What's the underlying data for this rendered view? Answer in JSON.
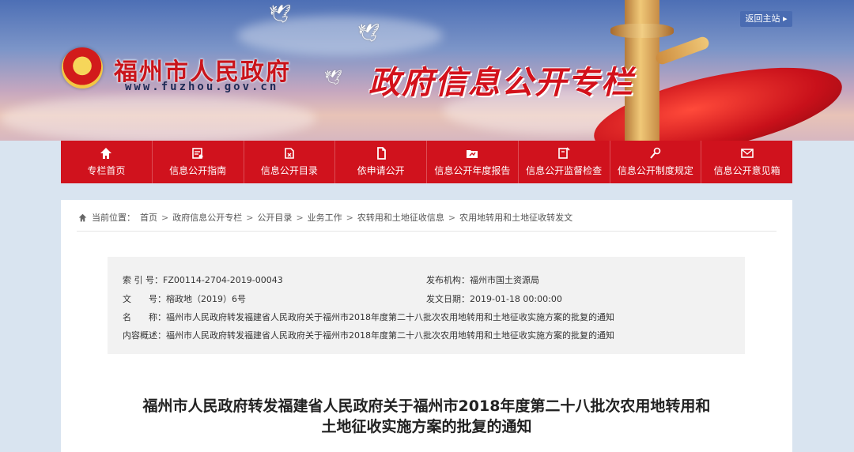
{
  "header": {
    "site_title": "福州市人民政府",
    "site_url": "www.fuzhou.gov.cn",
    "column_title": "政府信息公开专栏",
    "return_label": "返回主站"
  },
  "nav": {
    "items": [
      {
        "label": "专栏首页",
        "icon": "home-icon"
      },
      {
        "label": "信息公开指南",
        "icon": "guide-icon"
      },
      {
        "label": "信息公开目录",
        "icon": "catalog-icon"
      },
      {
        "label": "依申请公开",
        "icon": "document-icon"
      },
      {
        "label": "信息公开年度报告",
        "icon": "report-icon"
      },
      {
        "label": "信息公开监督检查",
        "icon": "inspection-icon"
      },
      {
        "label": "信息公开制度规定",
        "icon": "regulation-icon"
      },
      {
        "label": "信息公开意见箱",
        "icon": "mail-icon"
      }
    ],
    "colors": {
      "background": "#d0121d"
    }
  },
  "breadcrumb": {
    "prefix": "当前位置：",
    "items": [
      "首页",
      "政府信息公开专栏",
      "公开目录",
      "业务工作",
      "农转用和土地征收信息",
      "农用地转用和土地征收转发文"
    ],
    "separator": ">"
  },
  "meta": {
    "index_key": "索 引 号：",
    "index_value": "FZ00114-2704-2019-00043",
    "publisher_key": "发布机构：",
    "publisher_value": "福州市国土资源局",
    "docno_key": "文　　号：",
    "docno_value": "榕政地（2019）6号",
    "date_key": "发文日期：",
    "date_value": "2019-01-18 00:00:00",
    "name_key": "名　　称：",
    "name_value": "福州市人民政府转发福建省人民政府关于福州市2018年度第二十八批次农用地转用和土地征收实施方案的批复的通知",
    "summary_key": "内容概述：",
    "summary_value": "福州市人民政府转发福建省人民政府关于福州市2018年度第二十八批次农用地转用和土地征收实施方案的批复的通知"
  },
  "document": {
    "title_line1": "福州市人民政府转发福建省人民政府关于福州市2018年度第二十八批次农用地转用和",
    "title_line2": "土地征收实施方案的批复的通知"
  }
}
